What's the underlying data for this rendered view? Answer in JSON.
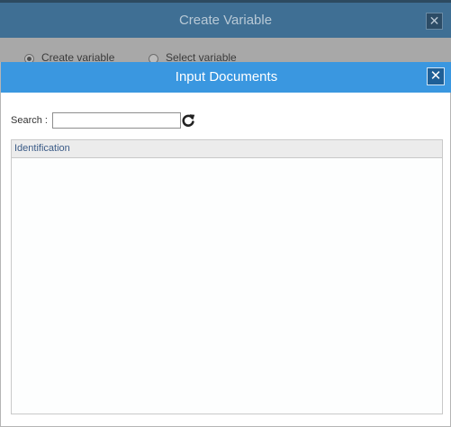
{
  "background_dialog": {
    "title": "Create Variable",
    "close_glyph": "✕",
    "options": [
      {
        "label": "Create variable",
        "checked": true
      },
      {
        "label": "Select variable",
        "checked": false
      }
    ]
  },
  "dialog": {
    "title": "Input Documents",
    "close_glyph": "✕",
    "search": {
      "label": "Search :",
      "value": "",
      "placeholder": ""
    },
    "refresh_icon": "refresh-icon",
    "grid": {
      "columns": [
        "Identification"
      ],
      "rows": []
    }
  },
  "colors": {
    "dialog_header": "#3a97e0",
    "background_header": "#3f6f94",
    "close_button": "#1f5f96"
  }
}
